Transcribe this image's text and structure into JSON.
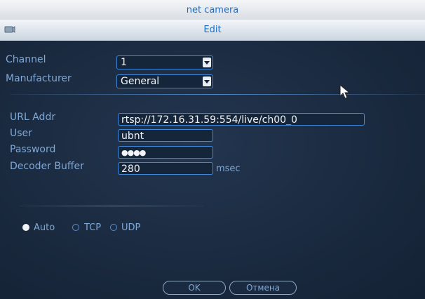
{
  "window": {
    "title": "net camera"
  },
  "dialog": {
    "title": "Edit"
  },
  "fields": {
    "channel": {
      "label": "Channel",
      "value": "1"
    },
    "manufacturer": {
      "label": "Manufacturer",
      "value": "General"
    },
    "url_addr": {
      "label": "URL Addr",
      "value": "rtsp://172.16.31.59:554/live/ch00_0"
    },
    "user": {
      "label": "User",
      "value": "ubnt"
    },
    "password": {
      "label": "Password",
      "value": "●●●●"
    },
    "decoder_buffer": {
      "label": "Decoder Buffer",
      "value": "280",
      "unit": "msec"
    }
  },
  "protocol": {
    "options": [
      {
        "label": "Auto",
        "selected": true
      },
      {
        "label": "TCP",
        "selected": false
      },
      {
        "label": "UDP",
        "selected": false
      }
    ]
  },
  "buttons": {
    "ok": "OK",
    "cancel": "Отмена"
  },
  "colors": {
    "accent": "#3f87d8",
    "label": "#7fa8d6",
    "title": "#1b6fc5"
  }
}
